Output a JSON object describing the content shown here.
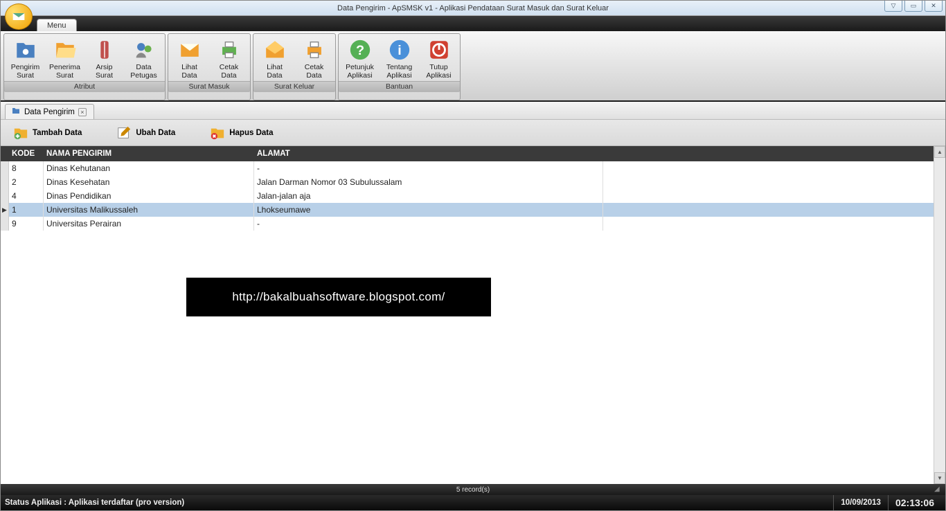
{
  "window": {
    "title": "Data Pengirim - ApSMSK v1 -  Aplikasi Pendataan Surat Masuk dan  Surat Keluar"
  },
  "menu": {
    "tab": "Menu"
  },
  "ribbon": {
    "groups": [
      {
        "name": "Atribut",
        "items": [
          {
            "label": "Pengirim\nSurat",
            "icon": "folder-user"
          },
          {
            "label": "Penerima\nSurat",
            "icon": "folder-open"
          },
          {
            "label": "Arsip\nSurat",
            "icon": "zipper"
          },
          {
            "label": "Data\nPetugas",
            "icon": "users"
          }
        ]
      },
      {
        "name": "Surat Masuk",
        "items": [
          {
            "label": "Lihat\nData",
            "icon": "mail"
          },
          {
            "label": "Cetak\nData",
            "icon": "printer"
          }
        ]
      },
      {
        "name": "Surat Keluar",
        "items": [
          {
            "label": "Lihat\nData",
            "icon": "mail-open"
          },
          {
            "label": "Cetak\nData",
            "icon": "printer-orange"
          }
        ]
      },
      {
        "name": "Bantuan",
        "items": [
          {
            "label": "Petunjuk\nAplikasi",
            "icon": "help"
          },
          {
            "label": "Tentang\nAplikasi",
            "icon": "info"
          },
          {
            "label": "Tutup\nAplikasi",
            "icon": "power"
          }
        ]
      }
    ]
  },
  "doc_tab": {
    "title": "Data Pengirim"
  },
  "toolbar": {
    "add": "Tambah Data",
    "edit": "Ubah Data",
    "delete": "Hapus Data"
  },
  "grid": {
    "headers": {
      "kode": "KODE",
      "nama": "NAMA PENGIRIM",
      "alamat": "ALAMAT"
    },
    "rows": [
      {
        "kode": "8",
        "nama": "Dinas Kehutanan",
        "alamat": "-",
        "selected": false
      },
      {
        "kode": "2",
        "nama": "Dinas Kesehatan",
        "alamat": "Jalan Darman Nomor 03 Subulussalam",
        "selected": false
      },
      {
        "kode": "4",
        "nama": "Dinas Pendidikan",
        "alamat": "Jalan-jalan aja",
        "selected": false
      },
      {
        "kode": "1",
        "nama": "Universitas Malikussaleh",
        "alamat": "Lhokseumawe",
        "selected": true
      },
      {
        "kode": "9",
        "nama": "Universitas Perairan",
        "alamat": "-",
        "selected": false
      }
    ]
  },
  "overlay": {
    "url": "http://bakalbuahsoftware.blogspot.com/"
  },
  "footer": {
    "records": "5 record(s)",
    "status": "Status Aplikasi : Aplikasi terdaftar (pro version)",
    "date": "10/09/2013",
    "time": "02:13:06"
  }
}
